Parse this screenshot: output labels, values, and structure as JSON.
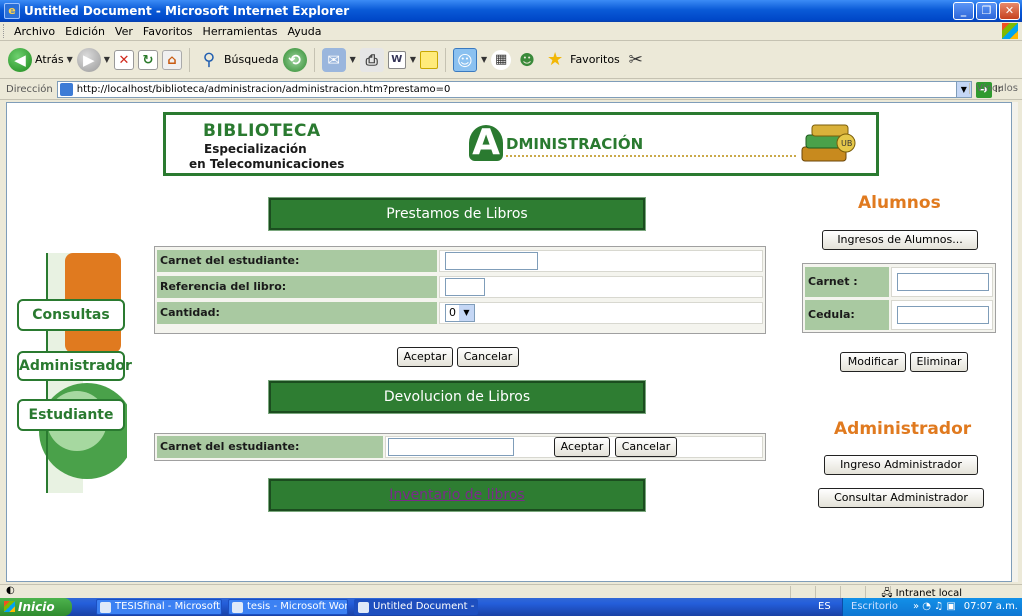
{
  "window": {
    "title": "Untitled Document - Microsoft Internet Explorer"
  },
  "menu": [
    "Archivo",
    "Edición",
    "Ver",
    "Favoritos",
    "Herramientas",
    "Ayuda"
  ],
  "toolbar": {
    "back_label": "Atrás",
    "search_label": "Búsqueda",
    "favorites_label": "Favoritos"
  },
  "address": {
    "label": "Dirección",
    "url": "http://localhost/biblioteca/administracion/administracion.htm?prestamo=0",
    "go_label": "Ir",
    "links_label": "Vínculos"
  },
  "banner": {
    "line1": "BIBLIOTECA",
    "line2": "Especialización",
    "line3": "en Telecomunicaciones",
    "admin_initial": "A",
    "admin_rest": "DMINISTRACIÓN"
  },
  "nav": {
    "consultas": "Consultas",
    "administrador": "Administrador",
    "estudiante": "Estudiante"
  },
  "prestamos": {
    "title": "Prestamos de Libros",
    "carnet_label": "Carnet del estudiante:",
    "referencia_label": "Referencia del libro:",
    "cantidad_label": "Cantidad:",
    "cantidad_value": "0",
    "accept": "Aceptar",
    "cancel": "Cancelar"
  },
  "devolucion": {
    "title": "Devolucion de Libros",
    "carnet_label": "Carnet del estudiante:",
    "accept": "Aceptar",
    "cancel": "Cancelar"
  },
  "inventario": {
    "link": "Inventario de libros"
  },
  "alumnos": {
    "title": "Alumnos",
    "ingresos_button": "Ingresos de Alumnos...",
    "carnet_label": "Carnet :",
    "cedula_label": "Cedula:",
    "modify": "Modificar",
    "delete": "Eliminar"
  },
  "administrador": {
    "title": "Administrador",
    "ingreso_button": "Ingreso Administrador",
    "consultar_button": "Consultar Administrador"
  },
  "status": {
    "zone": "Intranet local"
  },
  "taskbar": {
    "start": "Inicio",
    "tasks": [
      "TESISfinal - Microsoft...",
      "tesis - Microsoft Word",
      "Untitled Document - ..."
    ],
    "lang": "ES",
    "desktop": "Escritorio",
    "clock": "07:07 a.m."
  },
  "colors": {
    "green": "#2e7d32",
    "orange": "#e07a1f",
    "label_bg": "#a9c9a1"
  }
}
